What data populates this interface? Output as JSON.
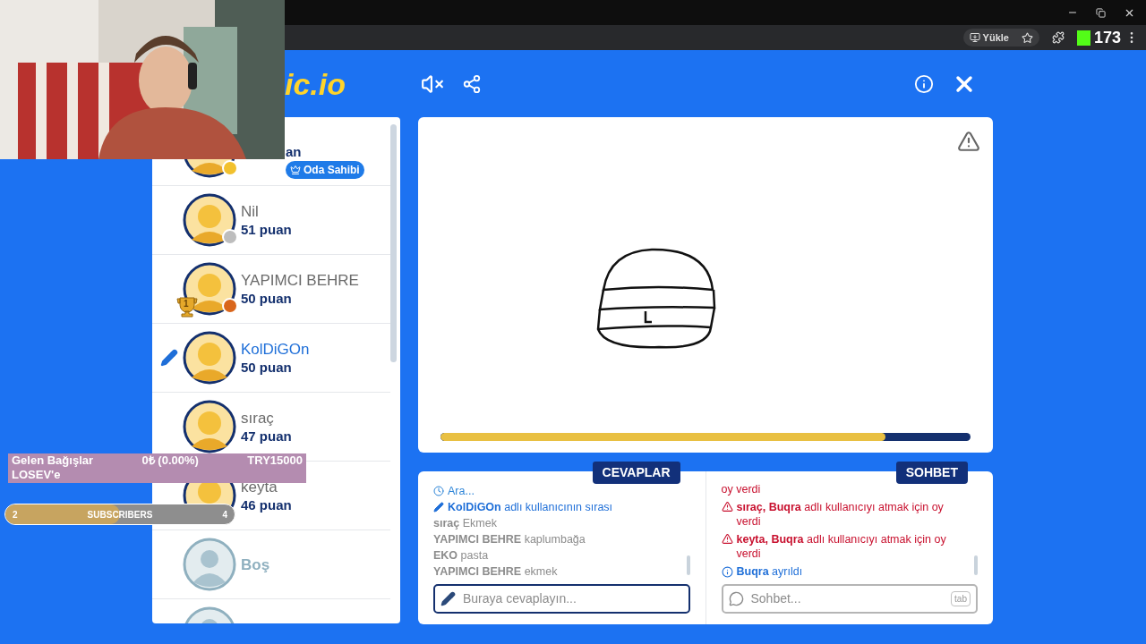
{
  "browser": {
    "upload_button": "Yükle",
    "extension_count": "173"
  },
  "logo": "ic.io",
  "players": [
    {
      "kind": "player",
      "score": "an",
      "badge": "Oda Sahibi",
      "color": "#f2c12e"
    },
    {
      "kind": "player",
      "name": "Nil",
      "score": "51 puan",
      "color": "#bdbdbd",
      "drawing": false
    },
    {
      "kind": "player",
      "name": "YAPIMCI BEHRE",
      "score": "50 puan",
      "color": "#d9661c",
      "trophy": "1",
      "drawing": false
    },
    {
      "kind": "player",
      "name": "KolDiGOn",
      "score": "50 puan",
      "drawing": true
    },
    {
      "kind": "player",
      "name": "sıraç",
      "score": "47 puan",
      "drawing": false
    },
    {
      "kind": "player",
      "name": "keyta",
      "score": "46 puan",
      "drawing": false
    },
    {
      "kind": "empty",
      "name": "Boş"
    },
    {
      "kind": "empty"
    }
  ],
  "canvas": {
    "timer": {
      "level": 0.84
    }
  },
  "answers": {
    "tab": "CEVAPLAR",
    "placeholder": "Buraya cevaplayın...",
    "messages": [
      {
        "kind": "system",
        "text": "Ara..."
      },
      {
        "kind": "turn",
        "user": "KolDiGOn",
        "text": "adlı kullanıcının sırası"
      },
      {
        "kind": "guess",
        "user": "sıraç",
        "text": "Ekmek"
      },
      {
        "kind": "guess",
        "user": "YAPIMCI BEHRE",
        "text": "kaplumbağa"
      },
      {
        "kind": "guess",
        "user": "EKO",
        "text": "pasta"
      },
      {
        "kind": "guess",
        "user": "YAPIMCI BEHRE",
        "text": "ekmek"
      }
    ]
  },
  "chat": {
    "tab": "SOHBET",
    "placeholder": "Sohbet...",
    "key_hint": "tab",
    "messages": [
      {
        "kind": "fragment",
        "text": "oy verdi"
      },
      {
        "kind": "vote",
        "user": "sıraç, Buqra",
        "text": "adlı kullanıcıyı atmak için oy verdi"
      },
      {
        "kind": "vote",
        "user": "keyta, Buqra",
        "text": "adlı kullanıcıyı atmak için oy verdi"
      },
      {
        "kind": "info",
        "user": "Buqra",
        "text": "ayrıldı"
      }
    ]
  },
  "donations": {
    "label": "Gelen Bağışlar",
    "amount": "0₺ (0.00%)",
    "goal": "TRY15000",
    "target": "LOSEV'e"
  },
  "subscribers": {
    "current": "2",
    "label": "SUBSCRIBERS",
    "goal": "4",
    "level": 0.5
  }
}
